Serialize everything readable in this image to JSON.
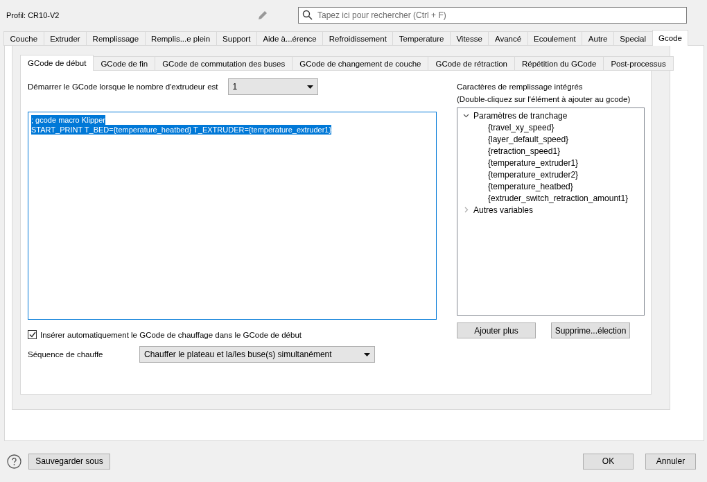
{
  "profile": {
    "label": "Profil: CR10-V2"
  },
  "search": {
    "placeholder": "Tapez ici pour rechercher (Ctrl + F)"
  },
  "tabs": [
    {
      "label": "Couche",
      "selected": false
    },
    {
      "label": "Extruder",
      "selected": false
    },
    {
      "label": "Remplissage",
      "selected": false
    },
    {
      "label": "Remplis...e plein",
      "selected": false
    },
    {
      "label": "Support",
      "selected": false
    },
    {
      "label": "Aide à...érence",
      "selected": false
    },
    {
      "label": "Refroidissement",
      "selected": false
    },
    {
      "label": "Temperature",
      "selected": false
    },
    {
      "label": "Vitesse",
      "selected": false
    },
    {
      "label": "Avancé",
      "selected": false
    },
    {
      "label": "Ecoulement",
      "selected": false
    },
    {
      "label": "Autre",
      "selected": false
    },
    {
      "label": "Special",
      "selected": false
    },
    {
      "label": "Gcode",
      "selected": true
    }
  ],
  "subtabs": [
    {
      "label": "GCode de début",
      "selected": true
    },
    {
      "label": "GCode de fin",
      "selected": false
    },
    {
      "label": "GCode de commutation des buses",
      "selected": false
    },
    {
      "label": "GCode de changement de couche",
      "selected": false
    },
    {
      "label": "GCode de rétraction",
      "selected": false
    },
    {
      "label": "Répétition du GCode",
      "selected": false
    },
    {
      "label": "Post-processus",
      "selected": false
    }
  ],
  "extruder_count": {
    "label": "Démarrer le GCode lorsque le nombre d'extrudeur est",
    "value": "1"
  },
  "editor": {
    "selected": true,
    "lines": [
      "; gcode macro Klipper",
      "START_PRINT T_BED={temperature_heatbed} T_EXTRUDER={temperature_extruder1}"
    ]
  },
  "placeholders": {
    "title": "Caractères de remplissage intégrés",
    "hint": "(Double-cliquez sur l'élément à ajouter au gcode)",
    "tree": [
      {
        "label": "Paramètres de tranchage",
        "expanded": true,
        "children": [
          {
            "label": "{travel_xy_speed}"
          },
          {
            "label": "{layer_default_speed}"
          },
          {
            "label": "{retraction_speed1}"
          },
          {
            "label": "{temperature_extruder1}"
          },
          {
            "label": "{temperature_extruder2}"
          },
          {
            "label": "{temperature_heatbed}"
          },
          {
            "label": "{extruder_switch_retraction_amount1}"
          }
        ]
      },
      {
        "label": "Autres variables",
        "expanded": false
      }
    ],
    "buttons": [
      "Ajouter plus",
      "Supprime...élection"
    ]
  },
  "auto_heat": {
    "label": "Insérer automatiquement le GCode de chauffage dans le GCode de début",
    "checked": true
  },
  "heat_sequence": {
    "label": "Séquence de chauffe",
    "value": "Chauffer le plateau et la/les buse(s) simultanément"
  },
  "footer": {
    "save_as": "Sauvegarder sous",
    "ok": "OK",
    "cancel": "Annuler"
  }
}
